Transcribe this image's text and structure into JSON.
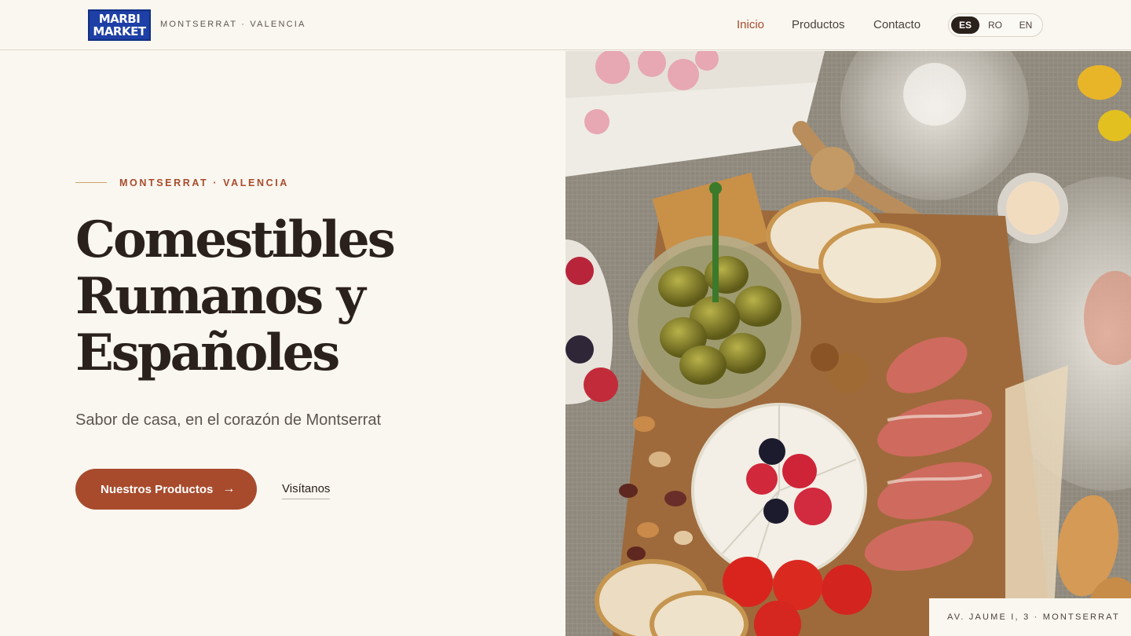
{
  "header": {
    "logo_line1": "MARBI",
    "logo_line2": "MARKET",
    "location": "MONTSERRAT · VALENCIA",
    "nav": [
      "Inicio",
      "Productos",
      "Contacto"
    ],
    "active_nav": "Inicio",
    "languages": [
      "ES",
      "RO",
      "EN"
    ],
    "active_language": "ES"
  },
  "hero": {
    "eyebrow": "MONTSERRAT · VALENCIA",
    "headline": [
      "Comestibles",
      "Rumanos y",
      "Españoles"
    ],
    "subtitle": "Sabor de casa, en el corazón de Montserrat",
    "cta_label": "Nuestros Productos",
    "cta_icon": "arrow-right-icon",
    "secondary_link": "Visítanos",
    "image_alt": "charcuterie-board-photo",
    "address": "AV. JAUME I, 3 · MONTSERRAT"
  },
  "colors": {
    "background": "#faf7f0",
    "accent": "#a84b2d",
    "text": "#2b211c",
    "logo_blue": "#1d3fa6"
  }
}
